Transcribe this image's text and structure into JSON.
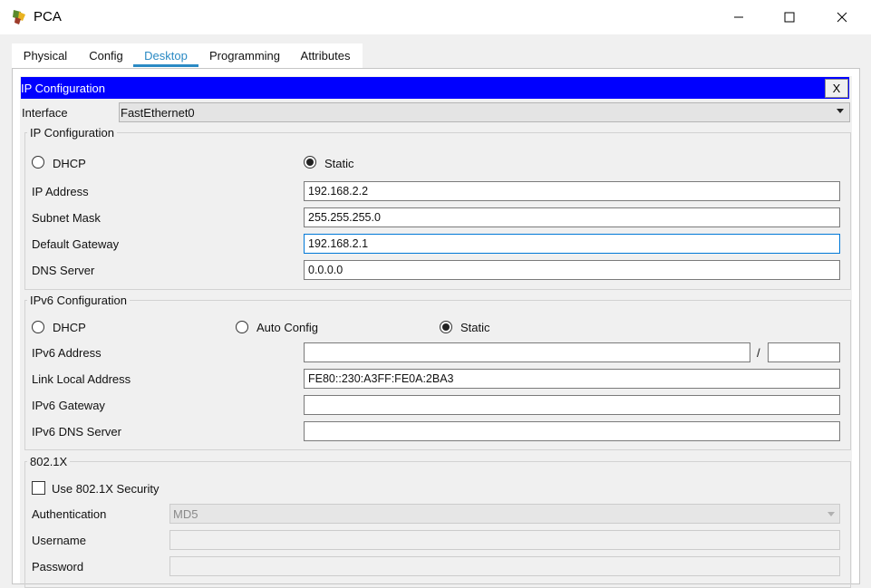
{
  "window": {
    "title": "PCA",
    "icon": "packet-tracer-pc-icon"
  },
  "tabs": [
    {
      "label": "Physical"
    },
    {
      "label": "Config"
    },
    {
      "label": "Desktop",
      "active": true
    },
    {
      "label": "Programming"
    },
    {
      "label": "Attributes"
    }
  ],
  "header": {
    "title": "IP Configuration",
    "close_label": "X",
    "color": "#0000ff"
  },
  "interface": {
    "label": "Interface",
    "value": "FastEthernet0"
  },
  "ipv4": {
    "title": "IP Configuration",
    "dhcp_label": "DHCP",
    "static_label": "Static",
    "mode": "Static",
    "ip_label": "IP Address",
    "ip_value": "192.168.2.2",
    "mask_label": "Subnet Mask",
    "mask_value": "255.255.255.0",
    "gateway_label": "Default Gateway",
    "gateway_value": "192.168.2.1",
    "dns_label": "DNS Server",
    "dns_value": "0.0.0.0"
  },
  "ipv6": {
    "title": "IPv6 Configuration",
    "dhcp_label": "DHCP",
    "auto_label": "Auto Config",
    "static_label": "Static",
    "mode": "Static",
    "addr_label": "IPv6 Address",
    "addr_value": "",
    "slash": "/",
    "prefix_value": "",
    "link_local_label": "Link Local Address",
    "link_local_value": "FE80::230:A3FF:FE0A:2BA3",
    "gateway_label": "IPv6 Gateway",
    "gateway_value": "",
    "dns_label": "IPv6 DNS Server",
    "dns_value": ""
  },
  "dot1x": {
    "title": "802.1X",
    "use_label": "Use 802.1X Security",
    "use_checked": false,
    "auth_label": "Authentication",
    "auth_value": "MD5",
    "username_label": "Username",
    "username_value": "",
    "password_label": "Password",
    "password_value": ""
  },
  "colors": {
    "accent_tab": "#2a8ac4",
    "focus_border": "#0078d7"
  }
}
